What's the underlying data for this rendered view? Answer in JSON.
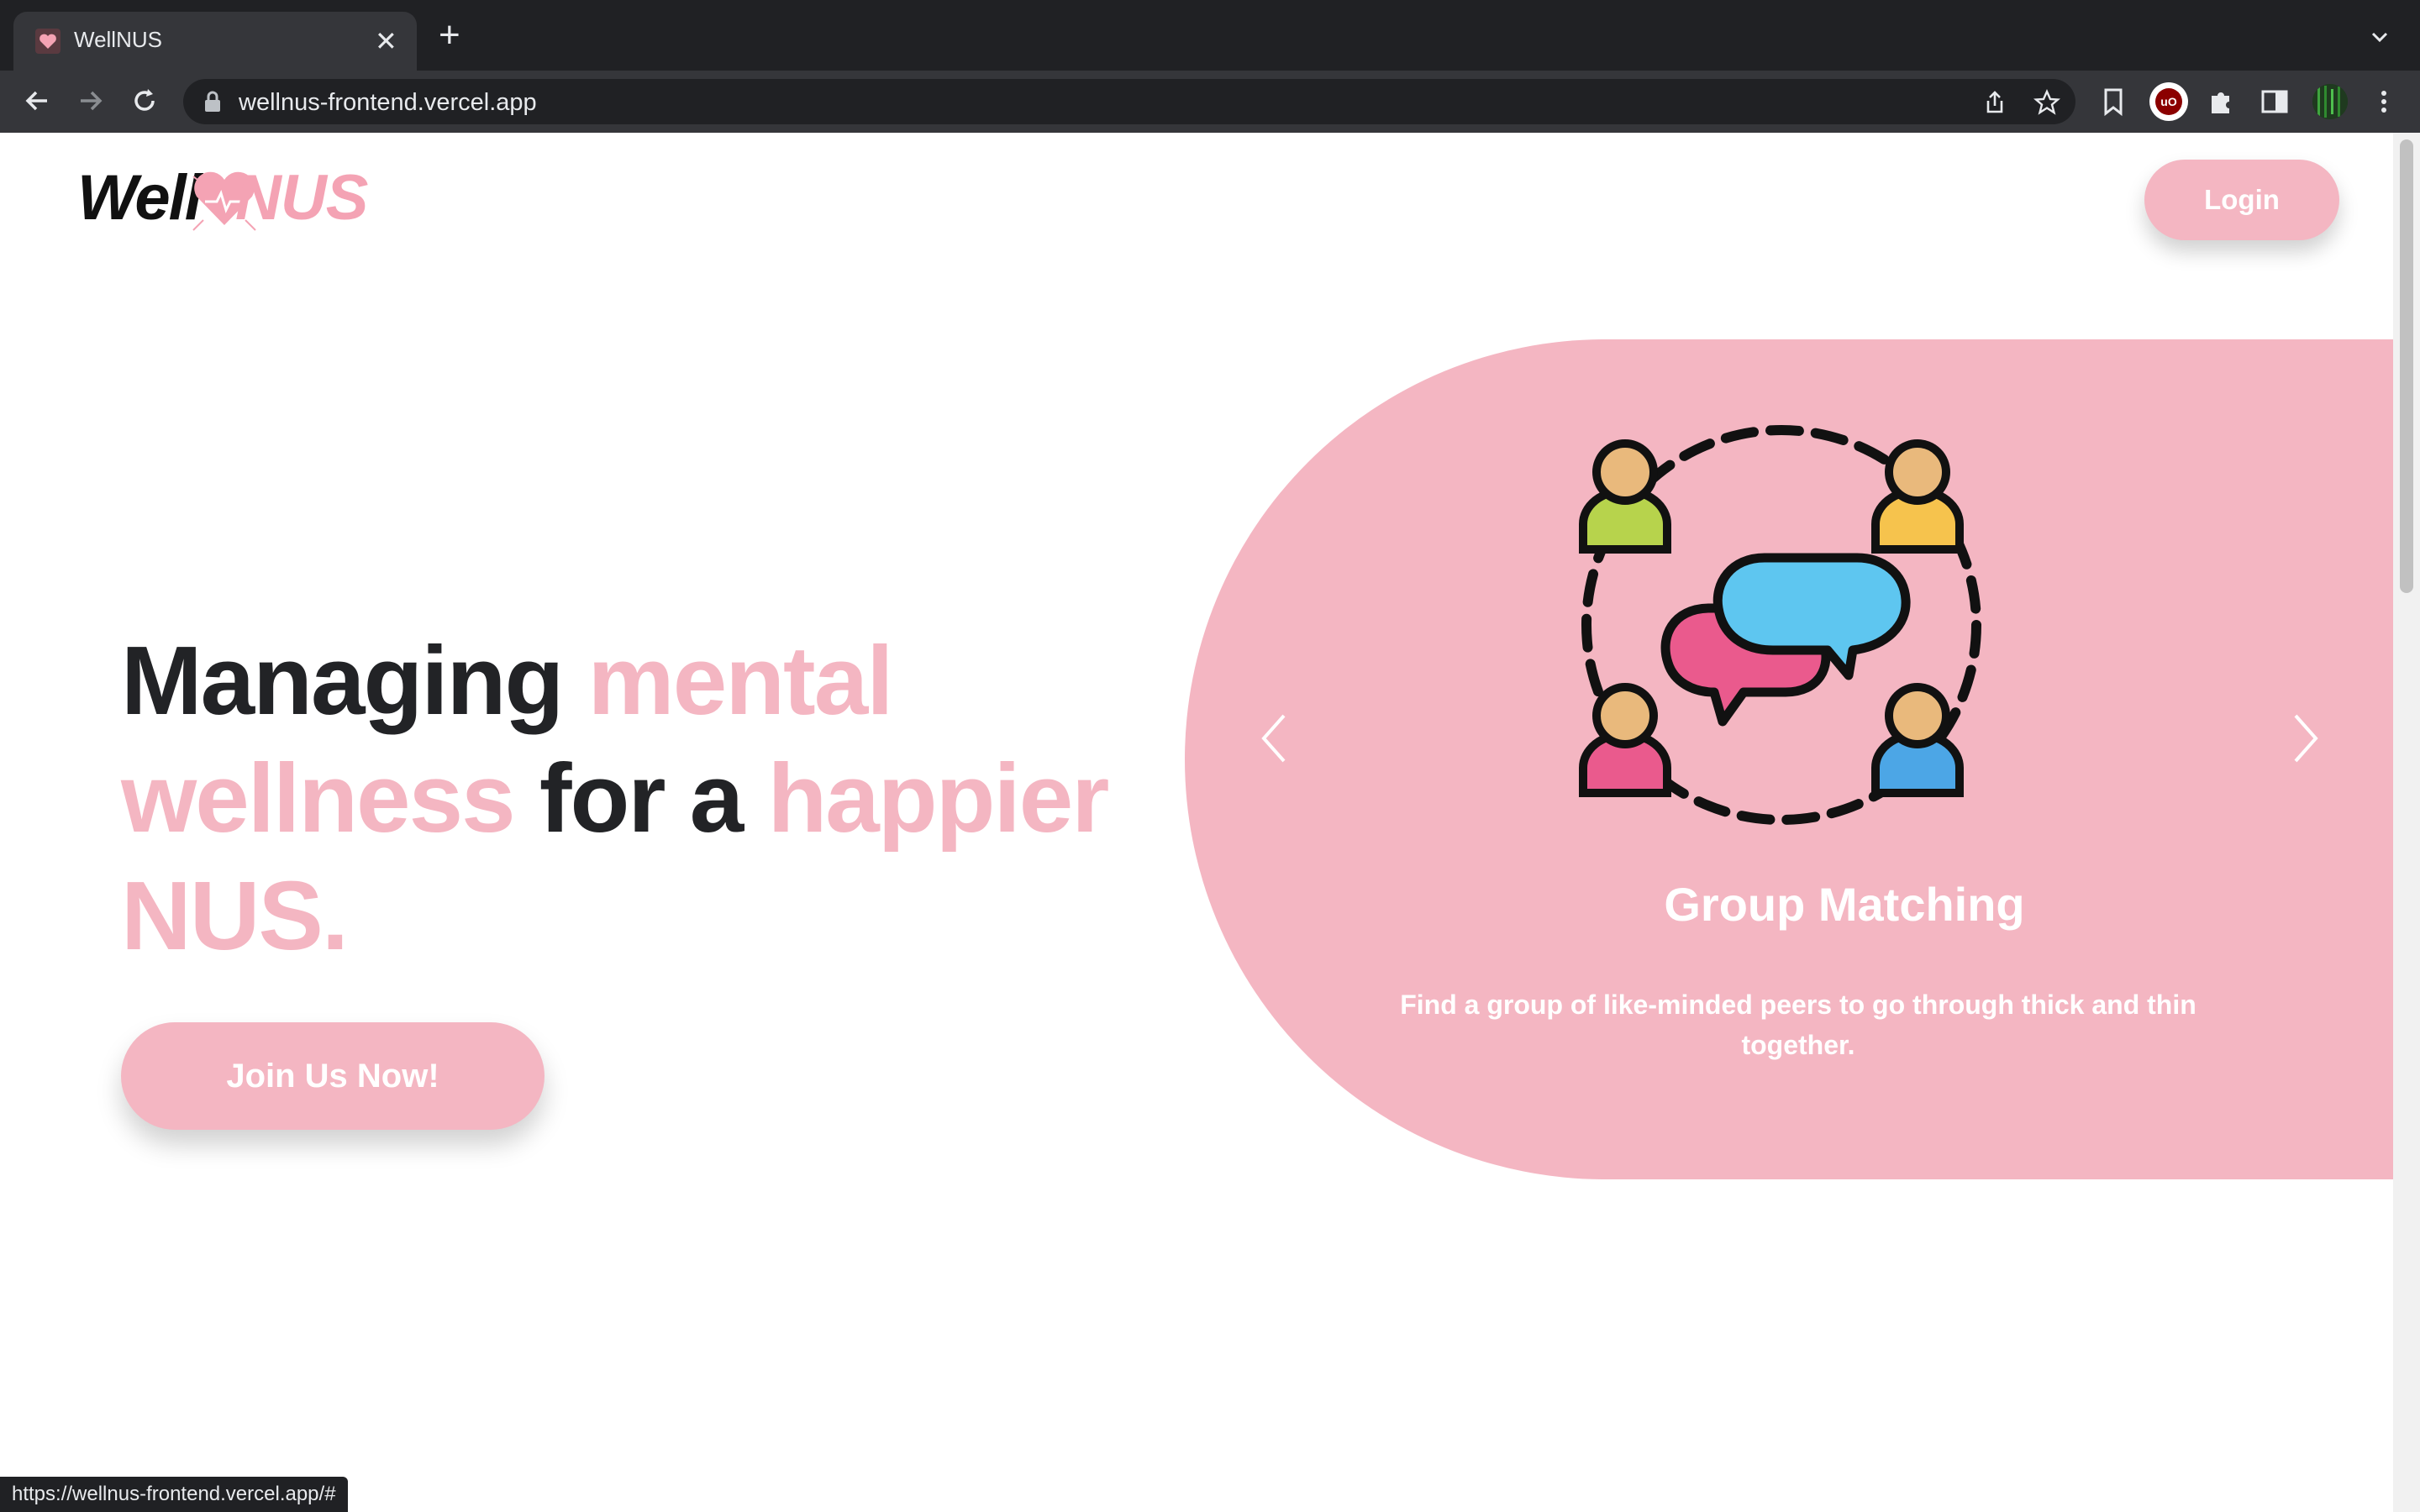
{
  "browser": {
    "tab_title": "WellNUS",
    "url": "wellnus-frontend.vercel.app",
    "status_url": "https://wellnus-frontend.vercel.app/#",
    "new_tab_symbol": "+",
    "close_symbol": "✕"
  },
  "header": {
    "logo_well": "Well",
    "logo_nus": "NUS",
    "login_label": "Login"
  },
  "hero": {
    "headline_1": "Managing ",
    "headline_2": "mental wellness",
    "headline_3": " for a ",
    "headline_4": "happier NUS.",
    "cta_label": "Join Us Now!"
  },
  "carousel": {
    "slide_title": "Group Matching",
    "slide_description": "Find a group of like-minded peers to go through thick and thin together.",
    "illustration": "group-chat-icon"
  },
  "colors": {
    "brand_pink": "#f4b6c2",
    "dark_text": "#222326"
  }
}
